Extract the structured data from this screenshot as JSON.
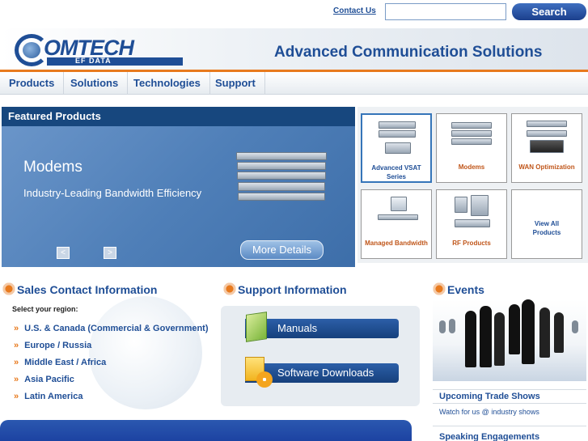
{
  "top": {
    "contact_label": "Contact Us",
    "search_placeholder": "",
    "search_label": "Search"
  },
  "header": {
    "logo_main": "OMTECH",
    "logo_sub": "EF DATA",
    "tagline": "Advanced Communication Solutions"
  },
  "nav": [
    "Products",
    "Solutions",
    "Technologies",
    "Support"
  ],
  "featured": {
    "title": "Featured Products",
    "product": "Modems",
    "description": "Industry-Leading Bandwidth Efficiency",
    "prev": "<",
    "next": ">",
    "more_label": "More Details"
  },
  "grid": [
    {
      "label": "Advanced VSAT Series"
    },
    {
      "label": "Modems"
    },
    {
      "label": "WAN Optimization"
    },
    {
      "label": "Managed Bandwidth"
    },
    {
      "label": "RF Products"
    },
    {
      "label": "View All Products"
    }
  ],
  "sales": {
    "title": "Sales Contact Information",
    "region_prompt": "Select your region:",
    "regions": [
      "U.S. & Canada (Commercial & Government)",
      "Europe / Russia",
      "Middle East / Africa",
      "Asia Pacific",
      "Latin America"
    ],
    "arrow": "»"
  },
  "support": {
    "title": "Support Information",
    "manuals": "Manuals",
    "downloads": "Software Downloads"
  },
  "events": {
    "title": "Events",
    "trade_title": "Upcoming Trade Shows",
    "trade_sub": "Watch for us @ industry shows",
    "speaking": "Speaking Engagements"
  },
  "colors": {
    "brand_blue": "#1f4e96",
    "accent_orange": "#e87a1e",
    "banner_blue": "#17477e"
  }
}
